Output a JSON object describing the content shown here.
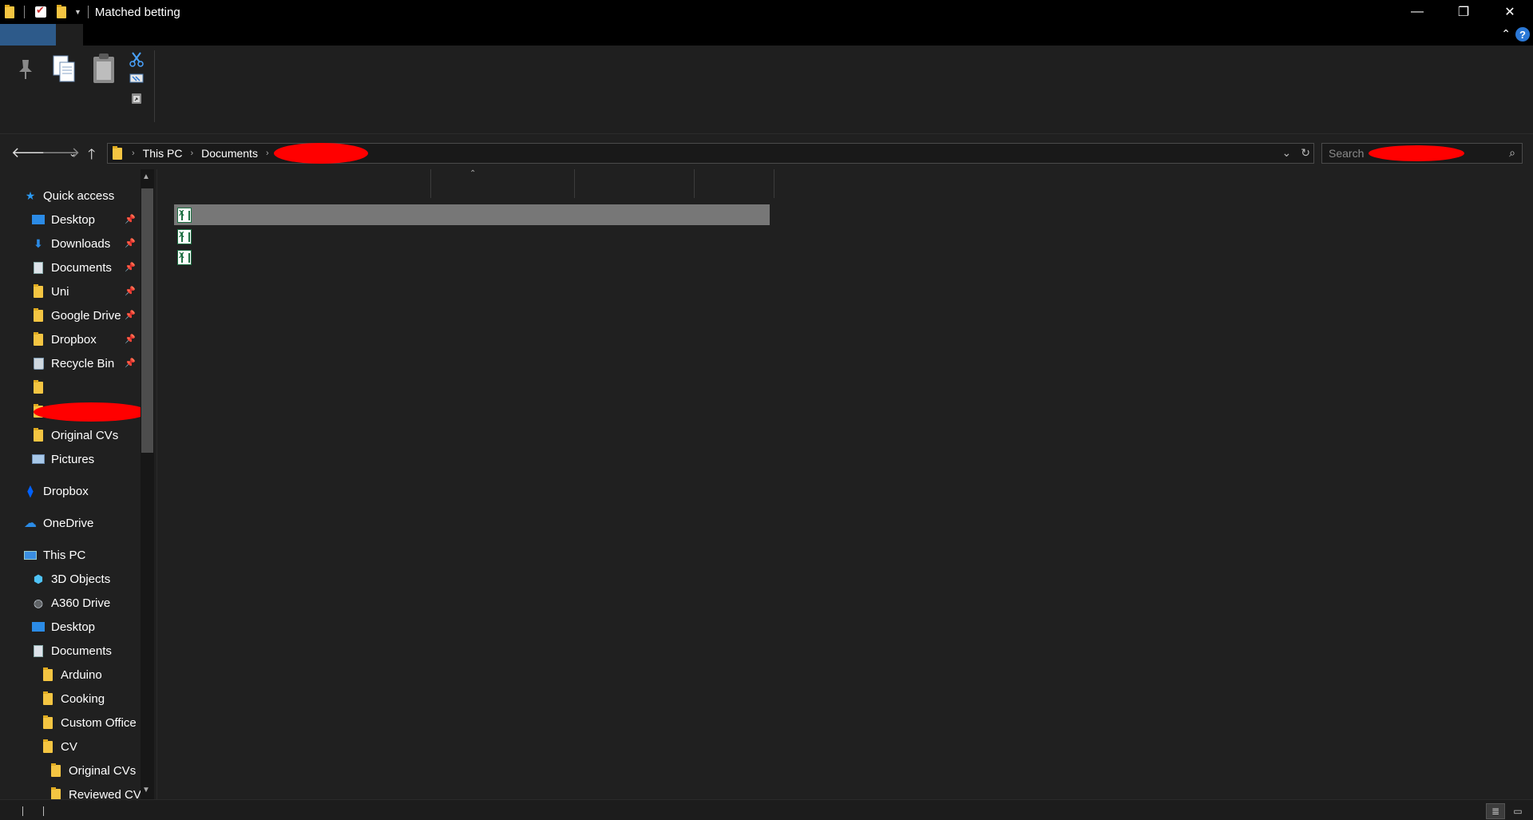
{
  "window": {
    "title": "Matched betting",
    "controls": {
      "minimize": "—",
      "maximize": "❐",
      "close": "✕"
    }
  },
  "ribbon": {
    "collapse_glyph": "⌃",
    "help_label": "?"
  },
  "address": {
    "crumbs": [
      "This PC",
      "Documents"
    ],
    "separator": "›"
  },
  "search": {
    "placeholder": "Search"
  },
  "nav": {
    "quick_access": "Quick access",
    "quick_items": [
      {
        "label": "Desktop",
        "icon": "desktop-icon"
      },
      {
        "label": "Downloads",
        "icon": "download-icon"
      },
      {
        "label": "Documents",
        "icon": "document-icon"
      },
      {
        "label": "Uni",
        "icon": "folder-icon"
      },
      {
        "label": "Google Drive",
        "icon": "google-drive-icon"
      },
      {
        "label": "Dropbox",
        "icon": "dropbox-folder-icon"
      },
      {
        "label": "Recycle Bin",
        "icon": "recycle-bin-icon"
      },
      {
        "label": "",
        "icon": "folder-icon"
      },
      {
        "label": "",
        "icon": "folder-icon"
      },
      {
        "label": "Original CVs",
        "icon": "folder-icon"
      },
      {
        "label": "Pictures",
        "icon": "pictures-icon"
      }
    ],
    "dropbox": "Dropbox",
    "onedrive": "OneDrive",
    "this_pc": "This PC",
    "pc_items": [
      {
        "label": "3D Objects",
        "icon": "3d-objects-icon"
      },
      {
        "label": "A360 Drive",
        "icon": "a360-drive-icon"
      },
      {
        "label": "Desktop",
        "icon": "desktop-icon"
      },
      {
        "label": "Documents",
        "icon": "document-icon"
      }
    ],
    "doc_children": [
      {
        "label": "Arduino"
      },
      {
        "label": "Cooking"
      },
      {
        "label": "Custom Office"
      },
      {
        "label": "CV"
      }
    ],
    "cv_children": [
      {
        "label": "Original CVs"
      },
      {
        "label": "Reviewed CVs"
      }
    ]
  },
  "files": [
    {
      "icon": "excel-file-icon",
      "selected": true
    },
    {
      "icon": "excel-file-icon",
      "selected": false
    },
    {
      "icon": "excel-file-icon",
      "selected": false
    }
  ],
  "colors": {
    "background": "#202020",
    "selection": "#777777",
    "accent": "#2d5a8a"
  }
}
